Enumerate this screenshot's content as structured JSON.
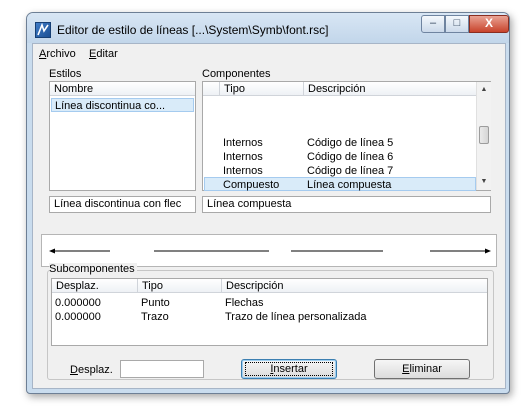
{
  "window": {
    "title": "Editor de estilo de líneas [...\\System\\Symb\\font.rsc]",
    "buttons": {
      "minimize": "–",
      "maximize": "□",
      "close": "X"
    }
  },
  "menu": {
    "archivo": {
      "accel": "A",
      "rest": "rchivo"
    },
    "editar": {
      "accel": "E",
      "rest": "ditar"
    }
  },
  "estilos": {
    "label": "Estilos",
    "header": "Nombre",
    "items": [
      "Línea discontinua co..."
    ],
    "name_value": "Línea discontinua con flec"
  },
  "componentes": {
    "label": "Componentes",
    "headers": [
      "Tipo",
      "Descripción"
    ],
    "rows": [
      {
        "tipo": "Internos",
        "descripcion": "Código de línea 5"
      },
      {
        "tipo": "Internos",
        "descripcion": "Código de línea 6"
      },
      {
        "tipo": "Internos",
        "descripcion": "Código de línea 7"
      },
      {
        "tipo": "Compuesto",
        "descripcion": "Línea compuesta"
      }
    ],
    "description_value": "Línea compuesta"
  },
  "subcomponentes": {
    "label": "Subcomponentes",
    "headers": [
      "Desplaz.",
      "Tipo",
      "Descripción"
    ],
    "rows": [
      {
        "desplaz": "0.000000",
        "tipo": "Punto",
        "descripcion": "Flechas"
      },
      {
        "desplaz": "0.000000",
        "tipo": "Trazo",
        "descripcion": "Trazo de línea personalizada"
      }
    ]
  },
  "controls": {
    "desplaz_label": {
      "accel": "D",
      "rest": "esplaz."
    },
    "desplaz_value": "",
    "insert_button": {
      "accel": "I",
      "rest": "nsertar"
    },
    "delete_button": {
      "accel": "E",
      "rest": "liminar"
    }
  },
  "icons": {
    "app": "app-icon",
    "scroll_up": "scroll-up-arrow-icon",
    "scroll_down": "scroll-down-arrow-icon",
    "grip": "scroll-thumb-grip-icon"
  },
  "colors": {
    "frame": "#c9dcee",
    "selection": "#d9ebf9",
    "close_button": "#c8432b"
  }
}
